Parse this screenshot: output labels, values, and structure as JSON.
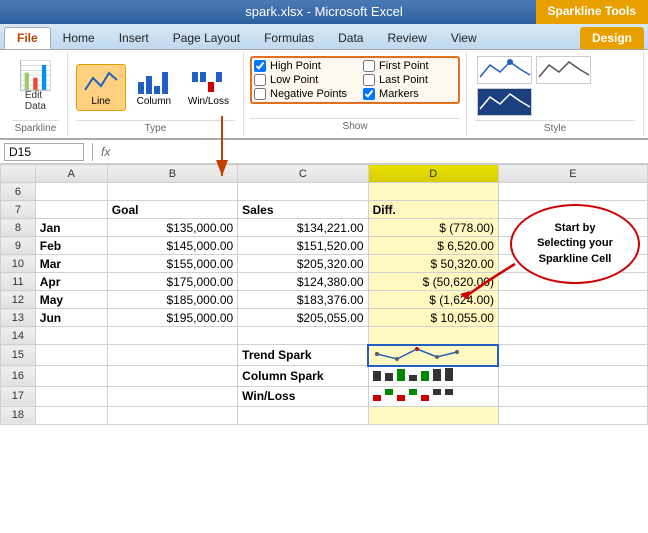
{
  "titleBar": {
    "text": "spark.xlsx - Microsoft Excel",
    "sparklineTools": "Sparkline Tools"
  },
  "ribbonTabs": {
    "tabs": [
      "File",
      "Home",
      "Insert",
      "Page Layout",
      "Formulas",
      "Data",
      "Review",
      "View"
    ],
    "activeTab": "Home",
    "designTab": "Design"
  },
  "ribbon": {
    "sparklineGroup": {
      "editData": "Edit\nData",
      "label": "Sparkline"
    },
    "typeGroup": {
      "label": "Type",
      "buttons": [
        "Line",
        "Column",
        "Win/Loss"
      ]
    },
    "showGroup": {
      "label": "Show",
      "checkboxes": [
        {
          "label": "High Point",
          "checked": true
        },
        {
          "label": "First Point",
          "checked": false
        },
        {
          "label": "Low Point",
          "checked": false
        },
        {
          "label": "Last Point",
          "checked": false
        },
        {
          "label": "Negative Points",
          "checked": false
        },
        {
          "label": "Markers",
          "checked": true
        }
      ]
    },
    "styleGroup": {
      "label": "Style"
    }
  },
  "formulaBar": {
    "nameBox": "D15",
    "fx": "fx"
  },
  "columns": {
    "widths": [
      "28px",
      "60px",
      "110px",
      "110px",
      "100px",
      "110px"
    ],
    "headers": [
      "",
      "A",
      "B",
      "C",
      "D",
      "E"
    ]
  },
  "rows": [
    {
      "num": "6",
      "cells": [
        "",
        "",
        "",
        "",
        "",
        ""
      ]
    },
    {
      "num": "7",
      "cells": [
        "",
        "",
        "Goal",
        "Sales",
        "Diff.",
        ""
      ]
    },
    {
      "num": "8",
      "cells": [
        "",
        "Jan",
        "$135,000.00",
        "$134,221.00",
        "$ (778.00)",
        ""
      ]
    },
    {
      "num": "9",
      "cells": [
        "",
        "Feb",
        "$145,000.00",
        "$151,520.00",
        "$ 6,520.00",
        ""
      ]
    },
    {
      "num": "10",
      "cells": [
        "",
        "Mar",
        "$155,000.00",
        "$205,320.00",
        "$ 50,320.00",
        ""
      ]
    },
    {
      "num": "11",
      "cells": [
        "",
        "Apr",
        "$175,000.00",
        "$124,380.00",
        "$ (50,620.00)",
        ""
      ]
    },
    {
      "num": "12",
      "cells": [
        "",
        "May",
        "$185,000.00",
        "$183,376.00",
        "$ (1,624.00)",
        ""
      ]
    },
    {
      "num": "13",
      "cells": [
        "",
        "Jun",
        "$195,000.00",
        "$205,055.00",
        "$ 10,055.00",
        ""
      ]
    },
    {
      "num": "14",
      "cells": [
        "",
        "",
        "",
        "",
        "",
        ""
      ]
    },
    {
      "num": "15",
      "cells": [
        "",
        "",
        "",
        "Trend Spark",
        "sparkline1",
        ""
      ]
    },
    {
      "num": "16",
      "cells": [
        "",
        "",
        "",
        "Column Spark",
        "sparkline2",
        ""
      ]
    },
    {
      "num": "17",
      "cells": [
        "",
        "",
        "",
        "Win/Loss",
        "sparkline3",
        ""
      ]
    },
    {
      "num": "18",
      "cells": [
        "",
        "",
        "",
        "",
        "",
        ""
      ]
    }
  ],
  "callout": {
    "text": "Start by\nSelecting your\nSparkline Cell"
  },
  "boldRows": [
    7,
    15,
    16,
    17
  ],
  "boldCols": {
    "7": [
      2,
      3
    ],
    "8": [
      1
    ],
    "9": [
      1
    ],
    "10": [
      1
    ],
    "11": [
      1
    ],
    "12": [
      1
    ],
    "13": [
      1
    ]
  }
}
